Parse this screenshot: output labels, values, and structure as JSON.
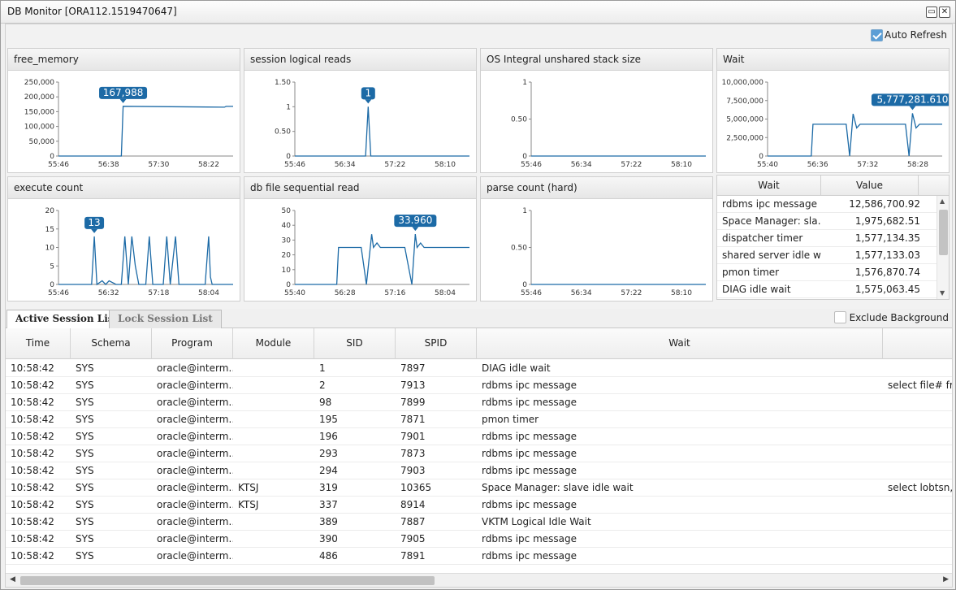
{
  "window": {
    "title": "DB Monitor [ORA112.1519470647]",
    "restore_glyph": "▭",
    "close_glyph": "✕"
  },
  "toolbar": {
    "auto_refresh_label": "Auto Refresh",
    "auto_refresh_checked": true
  },
  "accent_color": "#1c6aa6",
  "charts": [
    {
      "id": "c0",
      "title": "free_memory",
      "type": "line",
      "yticks": [
        "250,000",
        "200,000",
        "150,000",
        "100,000",
        "50,000",
        "0"
      ],
      "ylim": [
        0,
        250000
      ],
      "xticks": [
        "55:46",
        "56:38",
        "57:30",
        "58:22"
      ],
      "tooltip": "167,988",
      "x": [
        0,
        0.36,
        0.37,
        0.95,
        0.96,
        1.0
      ],
      "values": [
        0,
        0,
        168000,
        165000,
        167988,
        167988
      ]
    },
    {
      "id": "c1",
      "title": "session logical reads",
      "type": "line",
      "yticks": [
        "1.50",
        "1",
        "0.50",
        "0"
      ],
      "ylim": [
        0,
        1.5
      ],
      "xticks": [
        "55:46",
        "56:34",
        "57:22",
        "58:10"
      ],
      "tooltip": "1",
      "x": [
        0,
        0.405,
        0.42,
        0.435,
        1.0
      ],
      "values": [
        0,
        0,
        1,
        0,
        0
      ]
    },
    {
      "id": "c2",
      "title": "OS Integral unshared stack size",
      "type": "line",
      "yticks": [
        "1",
        "0.50",
        "0"
      ],
      "ylim": [
        0,
        1
      ],
      "xticks": [
        "55:46",
        "56:34",
        "57:22",
        "58:10"
      ],
      "tooltip": "",
      "x": [
        0,
        1
      ],
      "values": [
        0,
        0
      ]
    },
    {
      "id": "c3",
      "title": "Wait",
      "type": "line",
      "yticks": [
        "10,000,000",
        "7,500,000",
        "5,000,000",
        "2,500,000",
        "0"
      ],
      "ylim": [
        0,
        10000000
      ],
      "xticks": [
        "55:40",
        "56:36",
        "57:32",
        "58:28"
      ],
      "tooltip": "5,777,281.610",
      "x": [
        0,
        0.25,
        0.26,
        0.45,
        0.47,
        0.49,
        0.51,
        0.53,
        0.79,
        0.81,
        0.83,
        0.85,
        0.87,
        1.0
      ],
      "values": [
        0,
        0,
        4300000,
        4300000,
        0,
        5700000,
        3800000,
        4300000,
        4300000,
        0,
        5777281,
        3800000,
        4300000,
        4300000
      ]
    },
    {
      "id": "c4",
      "title": "execute count",
      "type": "line",
      "yticks": [
        "20",
        "15",
        "10",
        "5",
        "0"
      ],
      "ylim": [
        0,
        20
      ],
      "xticks": [
        "55:46",
        "56:32",
        "57:18",
        "58:04"
      ],
      "tooltip": "13",
      "x": [
        0,
        0.19,
        0.205,
        0.22,
        0.25,
        0.27,
        0.29,
        0.33,
        0.36,
        0.38,
        0.4,
        0.42,
        0.44,
        0.46,
        0.5,
        0.52,
        0.54,
        0.6,
        0.62,
        0.64,
        0.67,
        0.69,
        0.71,
        0.84,
        0.86,
        0.87,
        0.88,
        1.0
      ],
      "values": [
        0,
        0,
        13,
        0,
        1,
        0,
        1,
        0,
        0,
        13,
        0,
        13,
        5,
        0,
        0,
        13,
        0,
        0,
        13,
        0,
        13,
        0,
        0,
        0,
        13,
        2,
        0,
        0
      ]
    },
    {
      "id": "c5",
      "title": "db file sequential read",
      "type": "line",
      "yticks": [
        "50",
        "40",
        "30",
        "20",
        "10",
        "0"
      ],
      "ylim": [
        0,
        50
      ],
      "xticks": [
        "55:40",
        "56:28",
        "57:16",
        "58:04"
      ],
      "tooltip": "33.960",
      "x": [
        0,
        0.24,
        0.25,
        0.38,
        0.41,
        0.44,
        0.45,
        0.47,
        0.49,
        0.51,
        0.53,
        0.63,
        0.67,
        0.69,
        0.7,
        0.72,
        0.74,
        0.76,
        1.0
      ],
      "values": [
        0,
        0,
        25,
        25,
        0,
        33.96,
        25,
        28,
        25,
        25,
        25,
        25,
        0,
        34,
        25,
        28,
        25,
        25,
        25
      ]
    },
    {
      "id": "c6",
      "title": "parse count (hard)",
      "type": "line",
      "yticks": [
        "1",
        "0.50",
        "0"
      ],
      "ylim": [
        0,
        1
      ],
      "xticks": [
        "55:46",
        "56:34",
        "57:22",
        "58:10"
      ],
      "tooltip": "",
      "x": [
        0,
        1
      ],
      "values": [
        0,
        0
      ]
    }
  ],
  "wait_table": {
    "headers": [
      "Wait",
      "Value"
    ],
    "rows": [
      [
        "rdbms ipc message",
        "12,586,700.92"
      ],
      [
        "Space Manager: sla…",
        "1,975,682.51"
      ],
      [
        "dispatcher timer",
        "1,577,134.35"
      ],
      [
        "shared server idle w…",
        "1,577,133.03"
      ],
      [
        "pmon timer",
        "1,576,870.74"
      ],
      [
        "DIAG idle wait",
        "1,575,063.45"
      ]
    ]
  },
  "tabs": {
    "active": "Active Session List",
    "inactive": "Lock Session List"
  },
  "exclude_background": {
    "label": "Exclude Background",
    "checked": false
  },
  "session_grid": {
    "headers": [
      "Time",
      "Schema",
      "Program",
      "Module",
      "SID",
      "SPID",
      "Wait",
      ""
    ],
    "rows": [
      [
        "10:58:42",
        "SYS",
        "oracle@interm…",
        "",
        "1",
        "7897",
        "DIAG idle wait",
        ""
      ],
      [
        "10:58:42",
        "SYS",
        "oracle@interm…",
        "",
        "2",
        "7913",
        "rdbms ipc message",
        "select file# fro"
      ],
      [
        "10:58:42",
        "SYS",
        "oracle@interm…",
        "",
        "98",
        "7899",
        "rdbms ipc message",
        ""
      ],
      [
        "10:58:42",
        "SYS",
        "oracle@interm…",
        "",
        "195",
        "7871",
        "pmon timer",
        ""
      ],
      [
        "10:58:42",
        "SYS",
        "oracle@interm…",
        "",
        "196",
        "7901",
        "rdbms ipc message",
        ""
      ],
      [
        "10:58:42",
        "SYS",
        "oracle@interm…",
        "",
        "293",
        "7873",
        "rdbms ipc message",
        ""
      ],
      [
        "10:58:42",
        "SYS",
        "oracle@interm…",
        "",
        "294",
        "7903",
        "rdbms ipc message",
        ""
      ],
      [
        "10:58:42",
        "SYS",
        "oracle@interm…",
        "KTSJ",
        "319",
        "10365",
        "Space Manager: slave idle wait",
        "select lobtsn, l"
      ],
      [
        "10:58:42",
        "SYS",
        "oracle@interm…",
        "KTSJ",
        "337",
        "8914",
        "rdbms ipc message",
        ""
      ],
      [
        "10:58:42",
        "SYS",
        "oracle@interm…",
        "",
        "389",
        "7887",
        "VKTM Logical Idle Wait",
        ""
      ],
      [
        "10:58:42",
        "SYS",
        "oracle@interm…",
        "",
        "390",
        "7905",
        "rdbms ipc message",
        ""
      ],
      [
        "10:58:42",
        "SYS",
        "oracle@interm…",
        "",
        "486",
        "7891",
        "rdbms ipc message",
        ""
      ]
    ]
  }
}
